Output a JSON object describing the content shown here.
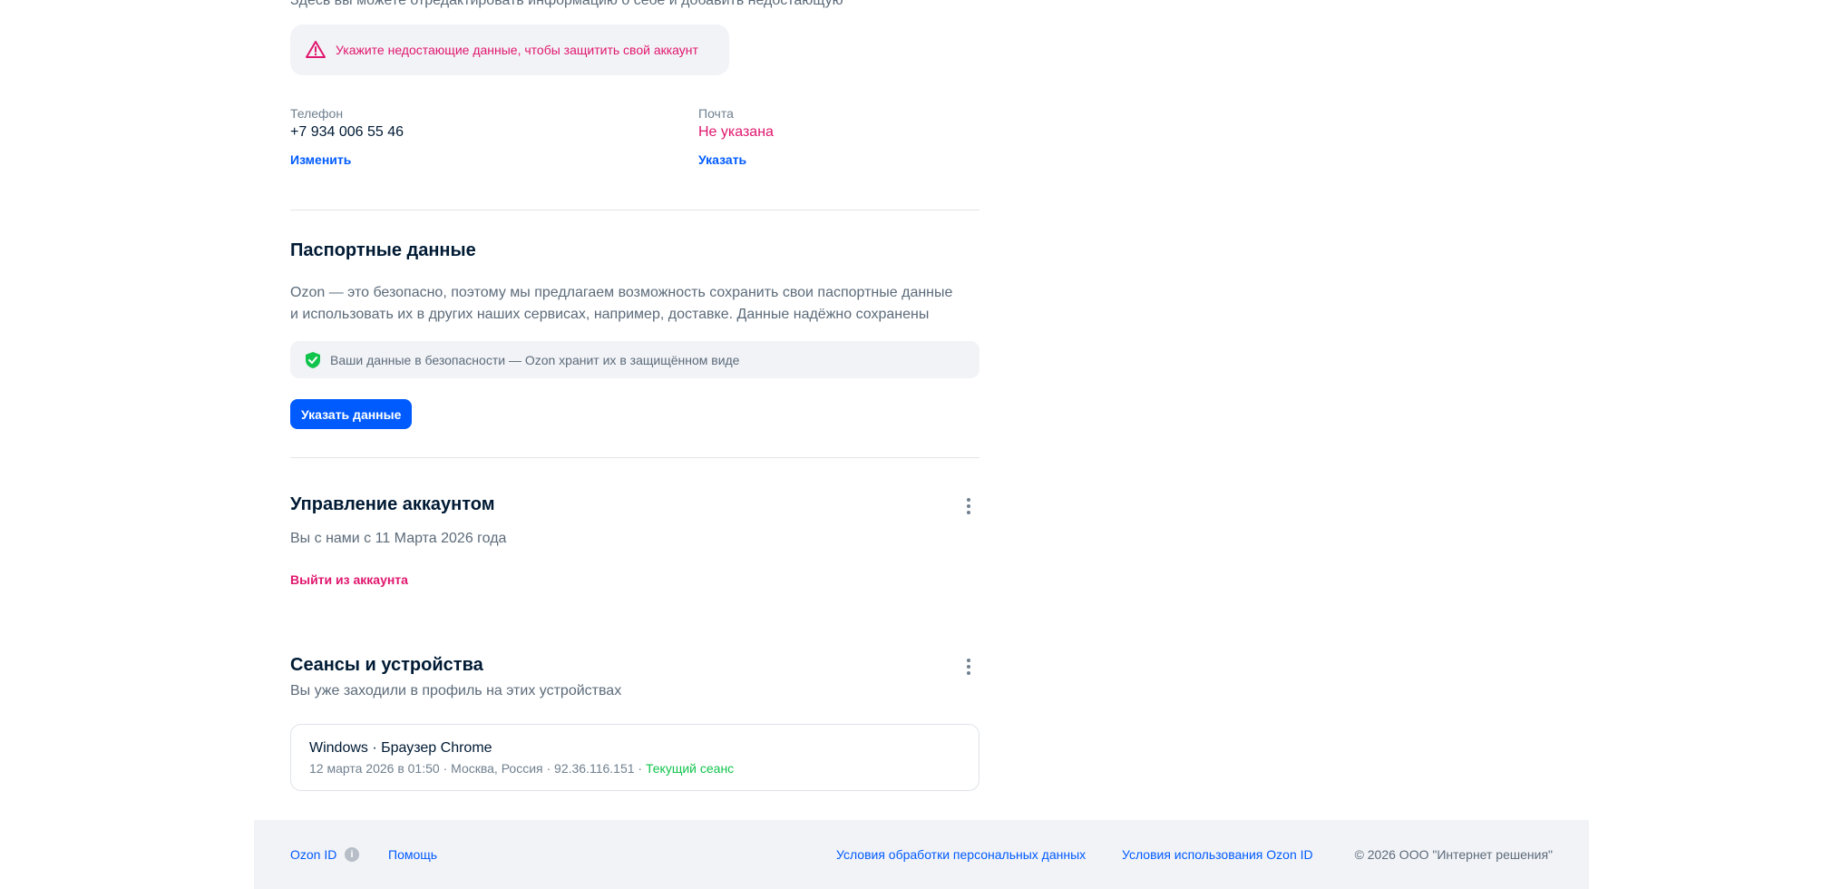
{
  "intro": {
    "text": "Здесь вы можете отредактировать информацию о себе и добавить недостающую"
  },
  "warning": {
    "text": "Укажите недостающие данные, чтобы защитить свой аккаунт",
    "icon": "warning-triangle-icon",
    "color": "#e0176e"
  },
  "phone": {
    "label": "Телефон",
    "value": "+7 934 006 55 46",
    "action": "Изменить"
  },
  "email": {
    "label": "Почта",
    "value": "Не указана",
    "action": "Указать"
  },
  "passport": {
    "title": "Паспортные данные",
    "desc_line1": "Ozon — это безопасно, поэтому мы предлагаем возможность сохранить свои паспортные данные",
    "desc_line2": "и использовать их в других наших сервисах, например, доставке. Данные надёжно сохранены",
    "secure_text": "Ваши данные в безопасности — Ozon хранит их в защищённом виде",
    "secure_icon": "shield-check-icon",
    "button": "Указать данные"
  },
  "account": {
    "title": "Управление аккаунтом",
    "since": "Вы с нами с 11 Марта 2026 года",
    "logout": "Выйти из аккаунта"
  },
  "sessions": {
    "title": "Сеансы и устройства",
    "subtitle": "Вы уже заходили в профиль на этих устройствах",
    "items": [
      {
        "device": "Windows · Браузер Chrome",
        "details": "12 марта 2026 в 01:50 · Москва, Россия · 92.36.116.151 · ",
        "current": "Текущий сеанс"
      }
    ]
  },
  "footer": {
    "ozon_id": "Ozon ID",
    "help": "Помощь",
    "personal_data_terms": "Условия обработки персональных данных",
    "ozon_id_terms": "Условия использования Ozon ID",
    "copyright": "© 2026 ООО \"Интернет решения\""
  },
  "colors": {
    "accent": "#005bff",
    "danger": "#e0176e",
    "success": "#10c44c",
    "background_arc": "#e6eefc"
  }
}
